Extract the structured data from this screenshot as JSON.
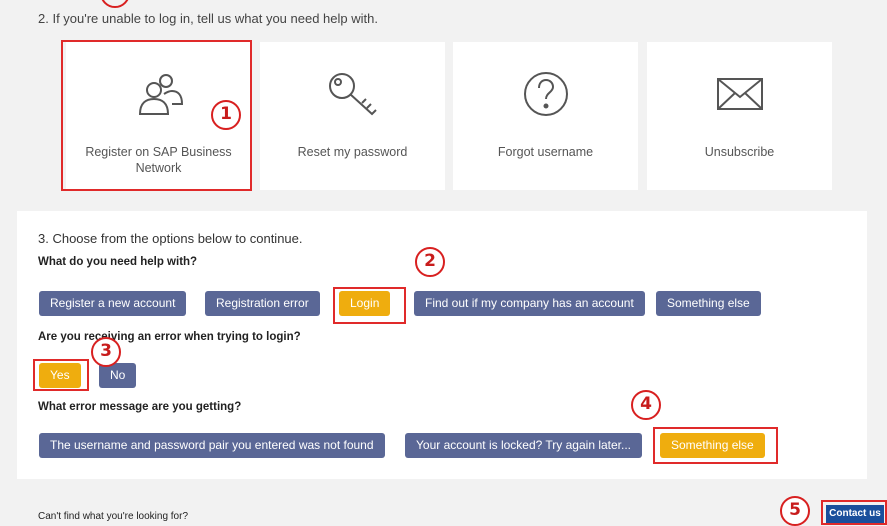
{
  "step2": {
    "title": "2. If you're unable to log in, tell us what you need help with.",
    "cards": [
      {
        "label": "Register on SAP Business Network",
        "icon": "users-icon"
      },
      {
        "label": "Reset my password",
        "icon": "key-icon"
      },
      {
        "label": "Forgot username",
        "icon": "question-circle-icon"
      },
      {
        "label": "Unsubscribe",
        "icon": "envelope-icon"
      }
    ]
  },
  "step3": {
    "title": "3. Choose from the options below to continue.",
    "q1": {
      "label": "What do you need help with?",
      "options": [
        "Register a new account",
        "Registration error",
        "Login",
        "Find out if my company has an account",
        "Something else"
      ],
      "selected": "Login"
    },
    "q2": {
      "label": "Are you receiving an error when trying to login?",
      "options": [
        "Yes",
        "No"
      ],
      "selected": "Yes"
    },
    "q3": {
      "label": "What error message are you getting?",
      "options": [
        "The username and password pair you entered was not found",
        "Your account is locked? Try again later...",
        "Something else"
      ],
      "selected": "Something else"
    }
  },
  "annotations": [
    "1",
    "2",
    "3",
    "4",
    "5"
  ],
  "footer": {
    "text": "Can't find what you're looking for?",
    "contact_label": "Contact us"
  },
  "colors": {
    "option": "#5a6796",
    "option_selected": "#efad0e",
    "highlight": "#e02a2a",
    "contact": "#1a4f9c"
  }
}
